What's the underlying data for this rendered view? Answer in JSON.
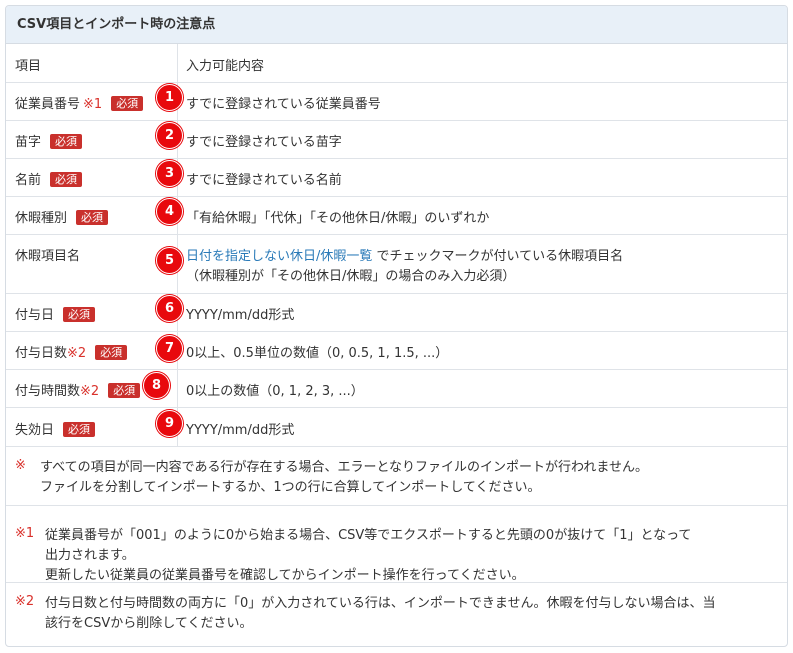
{
  "panel": {
    "title": "CSV項目とインポート時の注意点"
  },
  "table": {
    "header": {
      "item": "項目",
      "content": "入力可能内容"
    },
    "rows": [
      {
        "label": "従業員番号",
        "mark": "※1",
        "required": "必須",
        "badge": "1",
        "value": "すでに登録されている従業員番号"
      },
      {
        "label": "苗字",
        "mark": "",
        "required": "必須",
        "badge": "2",
        "value": "すでに登録されている苗字"
      },
      {
        "label": "名前",
        "mark": "",
        "required": "必須",
        "badge": "3",
        "value": "すでに登録されている名前"
      },
      {
        "label": "休暇種別",
        "mark": "",
        "required": "必須",
        "badge": "4",
        "value": "「有給休暇」「代休」「その他休日/休暇」のいずれか"
      },
      {
        "label": "休暇項目名",
        "mark": "",
        "required": "",
        "badge": "5",
        "value_link": "日付を指定しない休日/休暇一覧",
        "value": " でチェックマークが付いている休暇項目名",
        "value_line2": "（休暇種別が「その他休日/休暇」の場合のみ入力必須）"
      },
      {
        "label": "付与日",
        "mark": "",
        "required": "必須",
        "badge": "6",
        "value": "YYYY/mm/dd形式"
      },
      {
        "label": "付与日数",
        "mark": "※2",
        "required": "必須",
        "badge": "7",
        "value": "0以上、0.5単位の数値（0, 0.5, 1, 1.5, ...）"
      },
      {
        "label": "付与時間数",
        "mark": "※2",
        "required": "必須",
        "badge": "8",
        "value": "0以上の数値（0, 1, 2, 3, ...）"
      },
      {
        "label": "失効日",
        "mark": "",
        "required": "必須",
        "badge": "9",
        "value": "YYYY/mm/dd形式"
      }
    ]
  },
  "notes": [
    {
      "mark": "※",
      "lines": [
        "すべての項目が同一内容である行が存在する場合、エラーとなりファイルのインポートが行われません。",
        "ファイルを分割してインポートするか、1つの行に合算してインポートしてください。"
      ]
    },
    {
      "mark": "※1",
      "lines": [
        "従業員番号が「001」のように0から始まる場合、CSV等でエクスポートすると先頭の0が抜けて「1」となって",
        "出力されます。",
        "更新したい従業員の従業員番号を確認してからインポート操作を行ってください。"
      ]
    },
    {
      "mark": "※2",
      "lines": [
        "付与日数と付与時間数の両方に「0」が入力されている行は、インポートできません。休暇を付与しない場合は、当",
        "該行をCSVから削除してください。"
      ]
    }
  ],
  "colors": {
    "required_bg": "#c9302c",
    "badge_bg": "#e8090d",
    "mark": "#d9312b",
    "link": "#2a7ab8",
    "header_bg": "#e8f0f8"
  }
}
